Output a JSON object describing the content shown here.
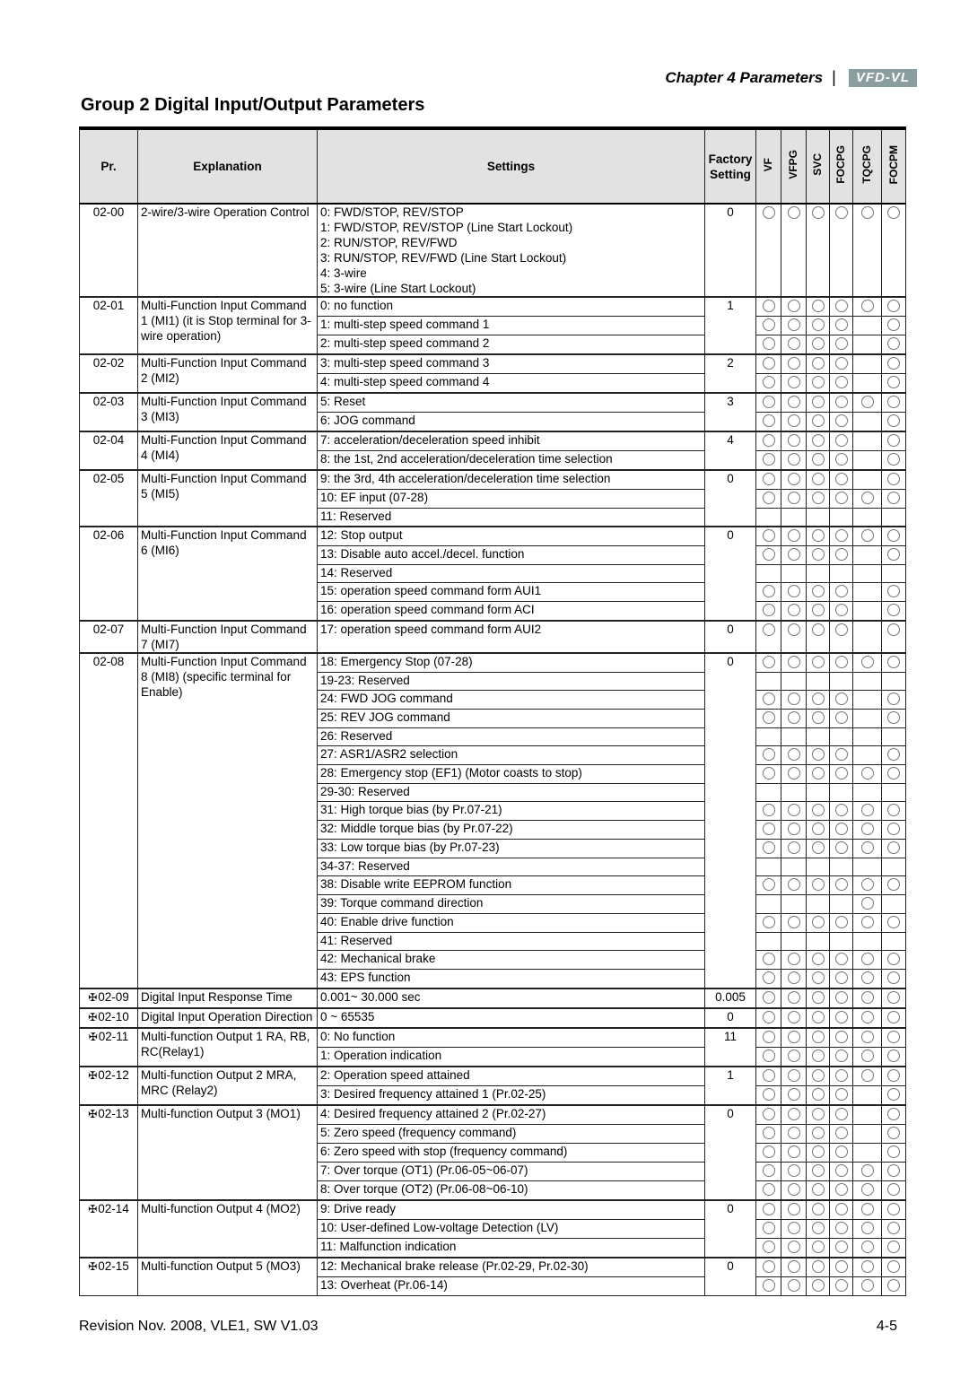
{
  "header": {
    "chapter": "Chapter 4 Parameters",
    "separator": "|",
    "logo": "VFD-VL"
  },
  "title": "Group 2 Digital Input/Output Parameters",
  "columns": {
    "pr": "Pr.",
    "explanation": "Explanation",
    "settings": "Settings",
    "factory": "Factory Setting",
    "modes": [
      "VF",
      "VFPG",
      "SVC",
      "FOCPG",
      "TQCPG",
      "FOCPM"
    ]
  },
  "mode_symbol": "circle",
  "parameters": [
    {
      "pr": "02-00",
      "editable": false,
      "explanation": "2-wire/3-wire Operation Control",
      "factory": "0",
      "settings": [
        {
          "text": [
            "0: FWD/STOP, REV/STOP",
            "1: FWD/STOP, REV/STOP (Line Start Lockout)",
            "2: RUN/STOP, REV/FWD",
            "3: RUN/STOP, REV/FWD (Line Start Lockout)",
            "4: 3-wire",
            "5: 3-wire (Line Start Lockout)"
          ],
          "modes": [
            1,
            1,
            1,
            1,
            1,
            1
          ]
        }
      ]
    },
    {
      "pr": "02-01",
      "editable": false,
      "explanation": "Multi-Function Input Command 1 (MI1) (it is Stop terminal for 3-wire operation)",
      "factory": "1",
      "settings": [
        {
          "text": [
            "0: no function"
          ],
          "modes": [
            1,
            1,
            1,
            1,
            1,
            1
          ]
        },
        {
          "text": [
            "1: multi-step speed command 1"
          ],
          "modes": [
            1,
            1,
            1,
            1,
            0,
            1
          ]
        },
        {
          "text": [
            "2: multi-step speed command 2"
          ],
          "modes": [
            1,
            1,
            1,
            1,
            0,
            1
          ]
        }
      ]
    },
    {
      "pr": "02-02",
      "editable": false,
      "explanation": "Multi-Function Input Command 2 (MI2)",
      "factory": "2",
      "settings": [
        {
          "text": [
            "3: multi-step speed command 3"
          ],
          "modes": [
            1,
            1,
            1,
            1,
            0,
            1
          ]
        },
        {
          "text": [
            "4: multi-step speed command 4"
          ],
          "modes": [
            1,
            1,
            1,
            1,
            0,
            1
          ]
        }
      ]
    },
    {
      "pr": "02-03",
      "editable": false,
      "explanation": "Multi-Function Input Command 3 (MI3)",
      "factory": "3",
      "settings": [
        {
          "text": [
            "5: Reset"
          ],
          "modes": [
            1,
            1,
            1,
            1,
            1,
            1
          ]
        },
        {
          "text": [
            "6: JOG command"
          ],
          "modes": [
            1,
            1,
            1,
            1,
            0,
            1
          ]
        }
      ]
    },
    {
      "pr": "02-04",
      "editable": false,
      "explanation": "Multi-Function Input Command 4 (MI4)",
      "factory": "4",
      "settings": [
        {
          "text": [
            "7: acceleration/deceleration speed inhibit"
          ],
          "modes": [
            1,
            1,
            1,
            1,
            0,
            1
          ]
        },
        {
          "text": [
            "8: the 1st, 2nd acceleration/deceleration time selection"
          ],
          "modes": [
            1,
            1,
            1,
            1,
            0,
            1
          ]
        }
      ]
    },
    {
      "pr": "02-05",
      "editable": false,
      "explanation": "Multi-Function Input Command 5 (MI5)",
      "factory": "0",
      "settings": [
        {
          "text": [
            "9: the 3rd, 4th acceleration/deceleration time selection"
          ],
          "modes": [
            1,
            1,
            1,
            1,
            0,
            1
          ]
        },
        {
          "text": [
            "10: EF input (07-28)"
          ],
          "modes": [
            1,
            1,
            1,
            1,
            1,
            1
          ]
        },
        {
          "text": [
            "11: Reserved"
          ],
          "modes": [
            0,
            0,
            0,
            0,
            0,
            0
          ]
        }
      ]
    },
    {
      "pr": "02-06",
      "editable": false,
      "explanation": "Multi-Function Input Command 6 (MI6)",
      "factory": "0",
      "settings": [
        {
          "text": [
            "12: Stop output"
          ],
          "modes": [
            1,
            1,
            1,
            1,
            1,
            1
          ]
        },
        {
          "text": [
            "13: Disable auto accel./decel. function"
          ],
          "modes": [
            1,
            1,
            1,
            1,
            0,
            1
          ]
        },
        {
          "text": [
            "14: Reserved"
          ],
          "modes": [
            0,
            0,
            0,
            0,
            0,
            0
          ]
        },
        {
          "text": [
            "15: operation speed command form AUI1"
          ],
          "modes": [
            1,
            1,
            1,
            1,
            0,
            1
          ]
        },
        {
          "text": [
            "16: operation speed command form ACI"
          ],
          "modes": [
            1,
            1,
            1,
            1,
            0,
            1
          ]
        }
      ]
    },
    {
      "pr": "02-07",
      "editable": false,
      "explanation": "Multi-Function Input Command 7 (MI7)",
      "factory": "0",
      "settings": [
        {
          "text": [
            "17: operation speed command form AUI2"
          ],
          "modes": [
            1,
            1,
            1,
            1,
            0,
            1
          ]
        }
      ]
    },
    {
      "pr": "02-08",
      "editable": false,
      "explanation": "Multi-Function Input Command 8 (MI8) (specific terminal for Enable)",
      "factory": "0",
      "settings": [
        {
          "text": [
            "18: Emergency Stop (07-28)"
          ],
          "modes": [
            1,
            1,
            1,
            1,
            1,
            1
          ]
        },
        {
          "text": [
            "19-23: Reserved"
          ],
          "modes": [
            0,
            0,
            0,
            0,
            0,
            0
          ]
        },
        {
          "text": [
            "24: FWD JOG command"
          ],
          "modes": [
            1,
            1,
            1,
            1,
            0,
            1
          ]
        },
        {
          "text": [
            "25: REV JOG command"
          ],
          "modes": [
            1,
            1,
            1,
            1,
            0,
            1
          ]
        },
        {
          "text": [
            "26: Reserved"
          ],
          "modes": [
            0,
            0,
            0,
            0,
            0,
            0
          ]
        },
        {
          "text": [
            "27: ASR1/ASR2 selection"
          ],
          "modes": [
            1,
            1,
            1,
            1,
            0,
            1
          ]
        },
        {
          "text": [
            "28: Emergency stop (EF1) (Motor coasts to stop)"
          ],
          "modes": [
            1,
            1,
            1,
            1,
            1,
            1
          ]
        },
        {
          "text": [
            "29-30: Reserved"
          ],
          "modes": [
            0,
            0,
            0,
            0,
            0,
            0
          ]
        },
        {
          "text": [
            "31: High torque bias (by Pr.07-21)"
          ],
          "modes": [
            1,
            1,
            1,
            1,
            1,
            1
          ]
        },
        {
          "text": [
            "32: Middle torque bias (by Pr.07-22)"
          ],
          "modes": [
            1,
            1,
            1,
            1,
            1,
            1
          ]
        },
        {
          "text": [
            "33: Low torque bias (by Pr.07-23)"
          ],
          "modes": [
            1,
            1,
            1,
            1,
            1,
            1
          ]
        },
        {
          "text": [
            "34-37: Reserved"
          ],
          "modes": [
            0,
            0,
            0,
            0,
            0,
            0
          ]
        },
        {
          "text": [
            "38: Disable write EEPROM function"
          ],
          "modes": [
            1,
            1,
            1,
            1,
            1,
            1
          ]
        },
        {
          "text": [
            "39: Torque command direction"
          ],
          "modes": [
            0,
            0,
            0,
            0,
            1,
            0
          ]
        },
        {
          "text": [
            "40: Enable drive function"
          ],
          "modes": [
            1,
            1,
            1,
            1,
            1,
            1
          ]
        },
        {
          "text": [
            "41: Reserved"
          ],
          "modes": [
            0,
            0,
            0,
            0,
            0,
            0
          ]
        },
        {
          "text": [
            "42: Mechanical brake"
          ],
          "modes": [
            1,
            1,
            1,
            1,
            1,
            1
          ]
        },
        {
          "text": [
            "43: EPS function"
          ],
          "modes": [
            1,
            1,
            1,
            1,
            1,
            1
          ]
        }
      ]
    },
    {
      "pr": "02-09",
      "editable": true,
      "explanation": "Digital Input Response Time",
      "factory": "0.005",
      "settings": [
        {
          "text": [
            "0.001~ 30.000 sec"
          ],
          "modes": [
            1,
            1,
            1,
            1,
            1,
            1
          ]
        }
      ]
    },
    {
      "pr": "02-10",
      "editable": true,
      "explanation": "Digital Input Operation Direction",
      "factory": "0",
      "settings": [
        {
          "text": [
            "0 ~ 65535"
          ],
          "modes": [
            1,
            1,
            1,
            1,
            1,
            1
          ]
        }
      ]
    },
    {
      "pr": "02-11",
      "editable": true,
      "explanation": "Multi-function Output 1 RA, RB, RC(Relay1)",
      "factory": "11",
      "settings": [
        {
          "text": [
            "0: No function"
          ],
          "modes": [
            1,
            1,
            1,
            1,
            1,
            1
          ]
        },
        {
          "text": [
            "1: Operation indication"
          ],
          "modes": [
            1,
            1,
            1,
            1,
            1,
            1
          ]
        }
      ]
    },
    {
      "pr": "02-12",
      "editable": true,
      "explanation": "Multi-function Output 2 MRA, MRC (Relay2)",
      "factory": "1",
      "settings": [
        {
          "text": [
            "2: Operation speed attained"
          ],
          "modes": [
            1,
            1,
            1,
            1,
            1,
            1
          ]
        },
        {
          "text": [
            "3: Desired frequency attained 1 (Pr.02-25)"
          ],
          "modes": [
            1,
            1,
            1,
            1,
            0,
            1
          ]
        }
      ]
    },
    {
      "pr": "02-13",
      "editable": true,
      "explanation": "Multi-function Output 3 (MO1)",
      "factory": "0",
      "settings": [
        {
          "text": [
            "4: Desired frequency attained 2 (Pr.02-27)"
          ],
          "modes": [
            1,
            1,
            1,
            1,
            0,
            1
          ]
        },
        {
          "text": [
            "5: Zero speed (frequency command)"
          ],
          "modes": [
            1,
            1,
            1,
            1,
            0,
            1
          ]
        },
        {
          "text": [
            "6: Zero speed with stop (frequency command)"
          ],
          "modes": [
            1,
            1,
            1,
            1,
            0,
            1
          ]
        },
        {
          "text": [
            "7: Over torque (OT1) (Pr.06-05~06-07)"
          ],
          "modes": [
            1,
            1,
            1,
            1,
            1,
            1
          ]
        },
        {
          "text": [
            "8: Over torque (OT2) (Pr.06-08~06-10)"
          ],
          "modes": [
            1,
            1,
            1,
            1,
            1,
            1
          ]
        }
      ]
    },
    {
      "pr": "02-14",
      "editable": true,
      "explanation": "Multi-function Output 4 (MO2)",
      "factory": "0",
      "settings": [
        {
          "text": [
            "9: Drive ready"
          ],
          "modes": [
            1,
            1,
            1,
            1,
            1,
            1
          ]
        },
        {
          "text": [
            "10: User-defined Low-voltage Detection (LV)"
          ],
          "modes": [
            1,
            1,
            1,
            1,
            1,
            1
          ]
        },
        {
          "text": [
            "11: Malfunction indication"
          ],
          "modes": [
            1,
            1,
            1,
            1,
            1,
            1
          ]
        }
      ]
    },
    {
      "pr": "02-15",
      "editable": true,
      "explanation": "Multi-function Output 5 (MO3)",
      "factory": "0",
      "settings": [
        {
          "text": [
            "12: Mechanical brake release (Pr.02-29, Pr.02-30)"
          ],
          "modes": [
            1,
            1,
            1,
            1,
            1,
            1
          ]
        },
        {
          "text": [
            "13: Overheat (Pr.06-14)"
          ],
          "modes": [
            1,
            1,
            1,
            1,
            1,
            1
          ]
        }
      ]
    }
  ],
  "edit_mark": "✠",
  "footer": {
    "revision": "Revision Nov. 2008, VLE1, SW V1.03",
    "page": "4-5"
  }
}
